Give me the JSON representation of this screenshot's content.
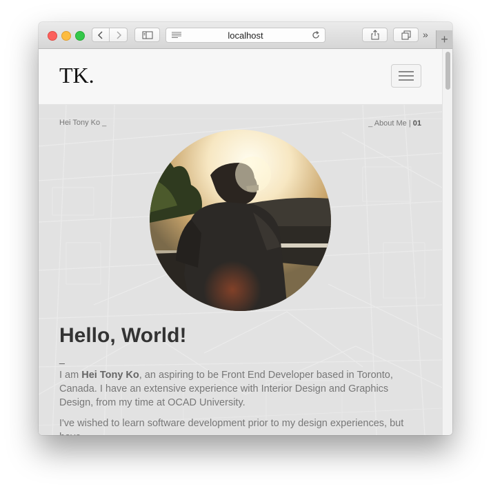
{
  "browser": {
    "url": "localhost",
    "more_label": "»",
    "new_tab_label": "+"
  },
  "site": {
    "logo": "TK.",
    "hero": {
      "name_small": "Hei Tony Ko _",
      "section_prefix": "_ About Me | ",
      "section_number": "01",
      "headline": "Hello, World!",
      "divider": "_",
      "intro_part1": "I am ",
      "intro_name": "Hei Tony Ko",
      "intro_part2": ", an aspiring to be Front End Developer based in Toronto, Canada. I have an extensive experience with Interior Design and Graphics Design, from my time at OCAD University.",
      "para2": "I've wished to learn software development prior to my design experiences, but have"
    }
  },
  "colors": {
    "traffic_red": "#fc605c",
    "traffic_yellow": "#fdbc40",
    "traffic_green": "#34c84a",
    "headline": "#333333",
    "body_text": "#777777"
  }
}
